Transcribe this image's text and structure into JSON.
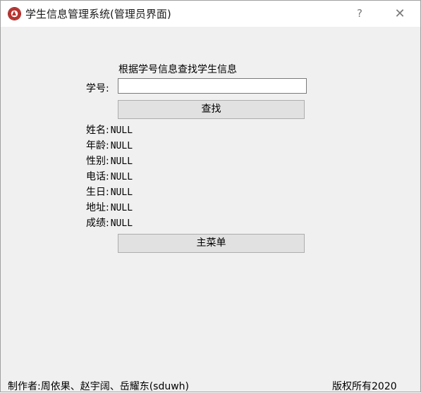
{
  "window": {
    "title": "学生信息管理系统(管理员界面)",
    "help_glyph": "?",
    "close_glyph": "✕"
  },
  "search": {
    "heading": "根据学号信息查找学生信息",
    "id_label": "学号:",
    "id_value": "",
    "search_button": "查找"
  },
  "info": [
    {
      "label": "姓名:",
      "value": "NULL"
    },
    {
      "label": "年龄:",
      "value": "NULL"
    },
    {
      "label": "性别:",
      "value": "NULL"
    },
    {
      "label": "电话:",
      "value": "NULL"
    },
    {
      "label": "生日:",
      "value": "NULL"
    },
    {
      "label": "地址:",
      "value": "NULL"
    },
    {
      "label": "成绩:",
      "value": "NULL"
    }
  ],
  "main_menu_button": "主菜单",
  "footer": {
    "author": "制作者:周依果、赵宇阔、岳耀东(sduwh)",
    "copyright": "版权所有2020"
  },
  "colors": {
    "window_bg": "#f0f0f0",
    "button_bg": "#e1e1e1",
    "icon_accent": "#b8322e"
  },
  "icons": {
    "app": "university-emblem-icon"
  }
}
